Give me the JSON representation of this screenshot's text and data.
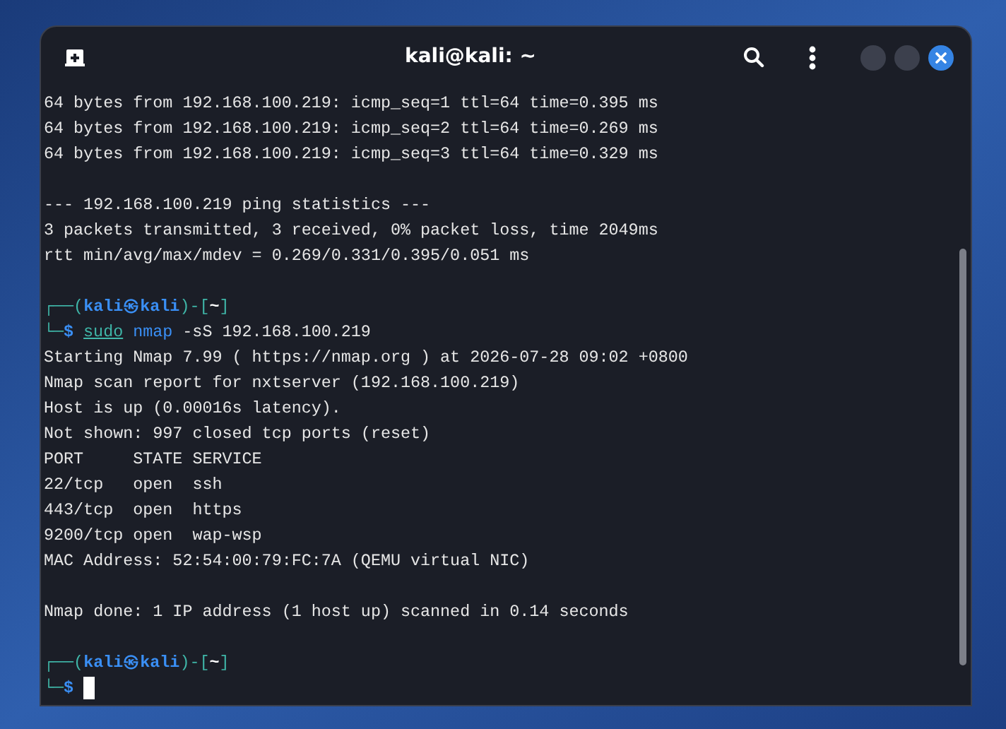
{
  "window": {
    "title": "kali@kali: ~"
  },
  "terminal": {
    "lines": [
      {
        "kind": "text",
        "text": "64 bytes from 192.168.100.219: icmp_seq=1 ttl=64 time=0.395 ms"
      },
      {
        "kind": "text",
        "text": "64 bytes from 192.168.100.219: icmp_seq=2 ttl=64 time=0.269 ms"
      },
      {
        "kind": "text",
        "text": "64 bytes from 192.168.100.219: icmp_seq=3 ttl=64 time=0.329 ms"
      },
      {
        "kind": "blank"
      },
      {
        "kind": "text",
        "text": "--- 192.168.100.219 ping statistics ---"
      },
      {
        "kind": "text",
        "text": "3 packets transmitted, 3 received, 0% packet loss, time 2049ms"
      },
      {
        "kind": "text",
        "text": "rtt min/avg/max/mdev = 0.269/0.331/0.395/0.051 ms"
      },
      {
        "kind": "blank"
      },
      {
        "kind": "prompt",
        "corner": "┌──(",
        "user": "kali",
        "at": "㉿",
        "host": "kali",
        "mid": ")-[",
        "dir": "~",
        "end": "]"
      },
      {
        "kind": "command",
        "corner": "└─",
        "symbol": "$",
        "sudo": "sudo",
        "program": "nmap",
        "args": "-sS 192.168.100.219"
      },
      {
        "kind": "text",
        "text": "Starting Nmap 7.99 ( https://nmap.org ) at 2026-07-28 09:02 +0800"
      },
      {
        "kind": "text",
        "text": "Nmap scan report for nxtserver (192.168.100.219)"
      },
      {
        "kind": "text",
        "text": "Host is up (0.00016s latency)."
      },
      {
        "kind": "text",
        "text": "Not shown: 997 closed tcp ports (reset)"
      },
      {
        "kind": "text",
        "text": "PORT     STATE SERVICE"
      },
      {
        "kind": "text",
        "text": "22/tcp   open  ssh"
      },
      {
        "kind": "text",
        "text": "443/tcp  open  https"
      },
      {
        "kind": "text",
        "text": "9200/tcp open  wap-wsp"
      },
      {
        "kind": "text",
        "text": "MAC Address: 52:54:00:79:FC:7A (QEMU virtual NIC)"
      },
      {
        "kind": "blank"
      },
      {
        "kind": "text",
        "text": "Nmap done: 1 IP address (1 host up) scanned in 0.14 seconds"
      },
      {
        "kind": "blank"
      },
      {
        "kind": "prompt",
        "corner": "┌──(",
        "user": "kali",
        "at": "㉿",
        "host": "kali",
        "mid": ")-[",
        "dir": "~",
        "end": "]"
      },
      {
        "kind": "input",
        "corner": "└─",
        "symbol": "$",
        "cursor": true
      }
    ]
  }
}
